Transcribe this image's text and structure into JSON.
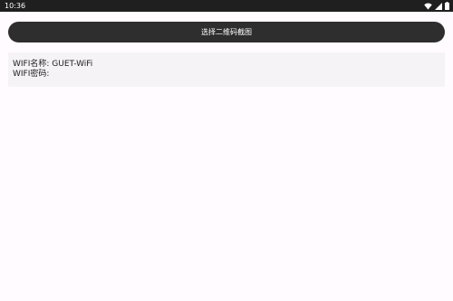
{
  "status_bar": {
    "time": "10:36",
    "icons": [
      "wifi-icon",
      "signal-icon",
      "battery-icon"
    ]
  },
  "main": {
    "pick_button_label": "选择二维码截图",
    "wifi_name_label": "WIFI名称: GUET-WiFi",
    "wifi_password_label": "WIFI密码:"
  },
  "colors": {
    "status_bar_bg": "#1f1f1f",
    "button_bg": "#2e2e2e",
    "panel_bg": "#f6f3f6",
    "page_bg": "#fffbfe"
  }
}
